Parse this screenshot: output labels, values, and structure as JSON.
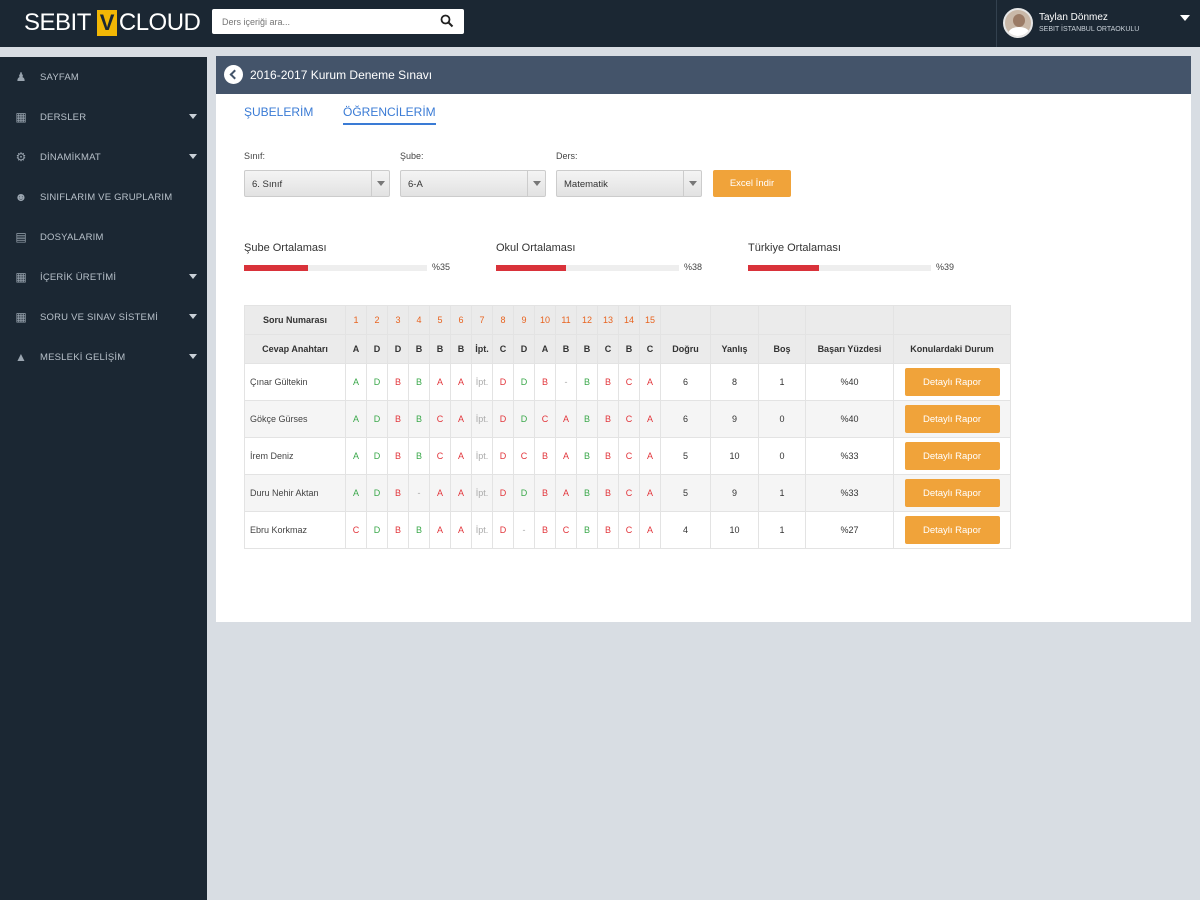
{
  "header": {
    "logo_left": "SEBIT",
    "logo_v": "V",
    "logo_right": "CLOUD",
    "search_placeholder": "Ders içeriği ara...",
    "user_name": "Taylan Dönmez",
    "user_school": "SEBIT İSTANBUL ORTAOKULU"
  },
  "sidebar": {
    "items": [
      {
        "label": "SAYFAM",
        "icon": "person-icon",
        "caret": false
      },
      {
        "label": "DERSLER",
        "icon": "lessons-icon",
        "caret": true
      },
      {
        "label": "DİNAMİKMAT",
        "icon": "gear-icon",
        "caret": true
      },
      {
        "label": "SINIFLARIM VE GRUPLARIM",
        "icon": "group-icon",
        "caret": false
      },
      {
        "label": "DOSYALARIM",
        "icon": "files-icon",
        "caret": false
      },
      {
        "label": "İÇERİK ÜRETİMİ",
        "icon": "content-icon",
        "caret": true
      },
      {
        "label": "SORU VE SINAV SİSTEMİ",
        "icon": "exam-icon",
        "caret": true
      },
      {
        "label": "MESLEKİ GELİŞİM",
        "icon": "graduation-icon",
        "caret": true
      }
    ]
  },
  "panel": {
    "title": "2016-2017 Kurum Deneme Sınavı",
    "tabs": [
      "ŞUBELERİM",
      "ÖĞRENCİLERİM"
    ],
    "active_tab": 1
  },
  "filters": {
    "sinif_label": "Sınıf:",
    "sinif_value": "6. Sınıf",
    "sube_label": "Şube:",
    "sube_value": "6-A",
    "ders_label": "Ders:",
    "ders_value": "Matematik",
    "excel_button": "Excel İndir"
  },
  "averages": [
    {
      "label": "Şube Ortalaması",
      "value_text": "%35",
      "percent": 35
    },
    {
      "label": "Okul Ortalaması",
      "value_text": "%38",
      "percent": 38
    },
    {
      "label": "Türkiye Ortalaması",
      "value_text": "%39",
      "percent": 39
    }
  ],
  "table": {
    "question_header": "Soru Numarası",
    "answer_key_header": "Cevap Anahtarı",
    "question_numbers": [
      "1",
      "2",
      "3",
      "4",
      "5",
      "6",
      "7",
      "8",
      "9",
      "10",
      "11",
      "12",
      "13",
      "14",
      "15"
    ],
    "answer_key": [
      "A",
      "D",
      "D",
      "B",
      "B",
      "B",
      "İpt.",
      "C",
      "D",
      "A",
      "B",
      "B",
      "C",
      "B",
      "C"
    ],
    "col_dogru": "Doğru",
    "col_yanlis": "Yanlış",
    "col_bos": "Boş",
    "col_basari": "Başarı Yüzdesi",
    "col_konu": "Konulardaki Durum",
    "rapor_label": "Detaylı Rapor",
    "rows": [
      {
        "name": "Çınar Gültekin",
        "answers": [
          [
            "A",
            "g"
          ],
          [
            "D",
            "g"
          ],
          [
            "B",
            "r"
          ],
          [
            "B",
            "g"
          ],
          [
            "A",
            "r"
          ],
          [
            "A",
            "r"
          ],
          [
            "İpt.",
            "x"
          ],
          [
            "D",
            "r"
          ],
          [
            "D",
            "g"
          ],
          [
            "B",
            "r"
          ],
          [
            "-",
            "x"
          ],
          [
            "B",
            "g"
          ],
          [
            "B",
            "r"
          ],
          [
            "C",
            "r"
          ],
          [
            "A",
            "r"
          ]
        ],
        "dogru": "6",
        "yanlis": "8",
        "bos": "1",
        "basari": "%40"
      },
      {
        "name": "Gökçe Gürses",
        "answers": [
          [
            "A",
            "g"
          ],
          [
            "D",
            "g"
          ],
          [
            "B",
            "r"
          ],
          [
            "B",
            "g"
          ],
          [
            "C",
            "r"
          ],
          [
            "A",
            "r"
          ],
          [
            "İpt.",
            "x"
          ],
          [
            "D",
            "r"
          ],
          [
            "D",
            "g"
          ],
          [
            "C",
            "r"
          ],
          [
            "A",
            "r"
          ],
          [
            "B",
            "g"
          ],
          [
            "B",
            "r"
          ],
          [
            "C",
            "r"
          ],
          [
            "A",
            "r"
          ]
        ],
        "dogru": "6",
        "yanlis": "9",
        "bos": "0",
        "basari": "%40"
      },
      {
        "name": "İrem Deniz",
        "answers": [
          [
            "A",
            "g"
          ],
          [
            "D",
            "g"
          ],
          [
            "B",
            "r"
          ],
          [
            "B",
            "g"
          ],
          [
            "C",
            "r"
          ],
          [
            "A",
            "r"
          ],
          [
            "İpt.",
            "x"
          ],
          [
            "D",
            "r"
          ],
          [
            "C",
            "r"
          ],
          [
            "B",
            "r"
          ],
          [
            "A",
            "r"
          ],
          [
            "B",
            "g"
          ],
          [
            "B",
            "r"
          ],
          [
            "C",
            "r"
          ],
          [
            "A",
            "r"
          ]
        ],
        "dogru": "5",
        "yanlis": "10",
        "bos": "0",
        "basari": "%33"
      },
      {
        "name": "Duru Nehir Aktan",
        "answers": [
          [
            "A",
            "g"
          ],
          [
            "D",
            "g"
          ],
          [
            "B",
            "r"
          ],
          [
            "-",
            "x"
          ],
          [
            "A",
            "r"
          ],
          [
            "A",
            "r"
          ],
          [
            "İpt.",
            "x"
          ],
          [
            "D",
            "r"
          ],
          [
            "D",
            "g"
          ],
          [
            "B",
            "r"
          ],
          [
            "A",
            "r"
          ],
          [
            "B",
            "g"
          ],
          [
            "B",
            "r"
          ],
          [
            "C",
            "r"
          ],
          [
            "A",
            "r"
          ]
        ],
        "dogru": "5",
        "yanlis": "9",
        "bos": "1",
        "basari": "%33"
      },
      {
        "name": "Ebru Korkmaz",
        "answers": [
          [
            "C",
            "r"
          ],
          [
            "D",
            "g"
          ],
          [
            "B",
            "r"
          ],
          [
            "B",
            "g"
          ],
          [
            "A",
            "r"
          ],
          [
            "A",
            "r"
          ],
          [
            "İpt.",
            "x"
          ],
          [
            "D",
            "r"
          ],
          [
            "-",
            "x"
          ],
          [
            "B",
            "r"
          ],
          [
            "C",
            "r"
          ],
          [
            "B",
            "g"
          ],
          [
            "B",
            "r"
          ],
          [
            "C",
            "r"
          ],
          [
            "A",
            "r"
          ]
        ],
        "dogru": "4",
        "yanlis": "10",
        "bos": "1",
        "basari": "%27"
      }
    ]
  },
  "colors": {
    "correct": "#3aa84a",
    "wrong": "#e2353b",
    "accent": "#f0a33a",
    "sidebar_bg": "#1b2733"
  }
}
